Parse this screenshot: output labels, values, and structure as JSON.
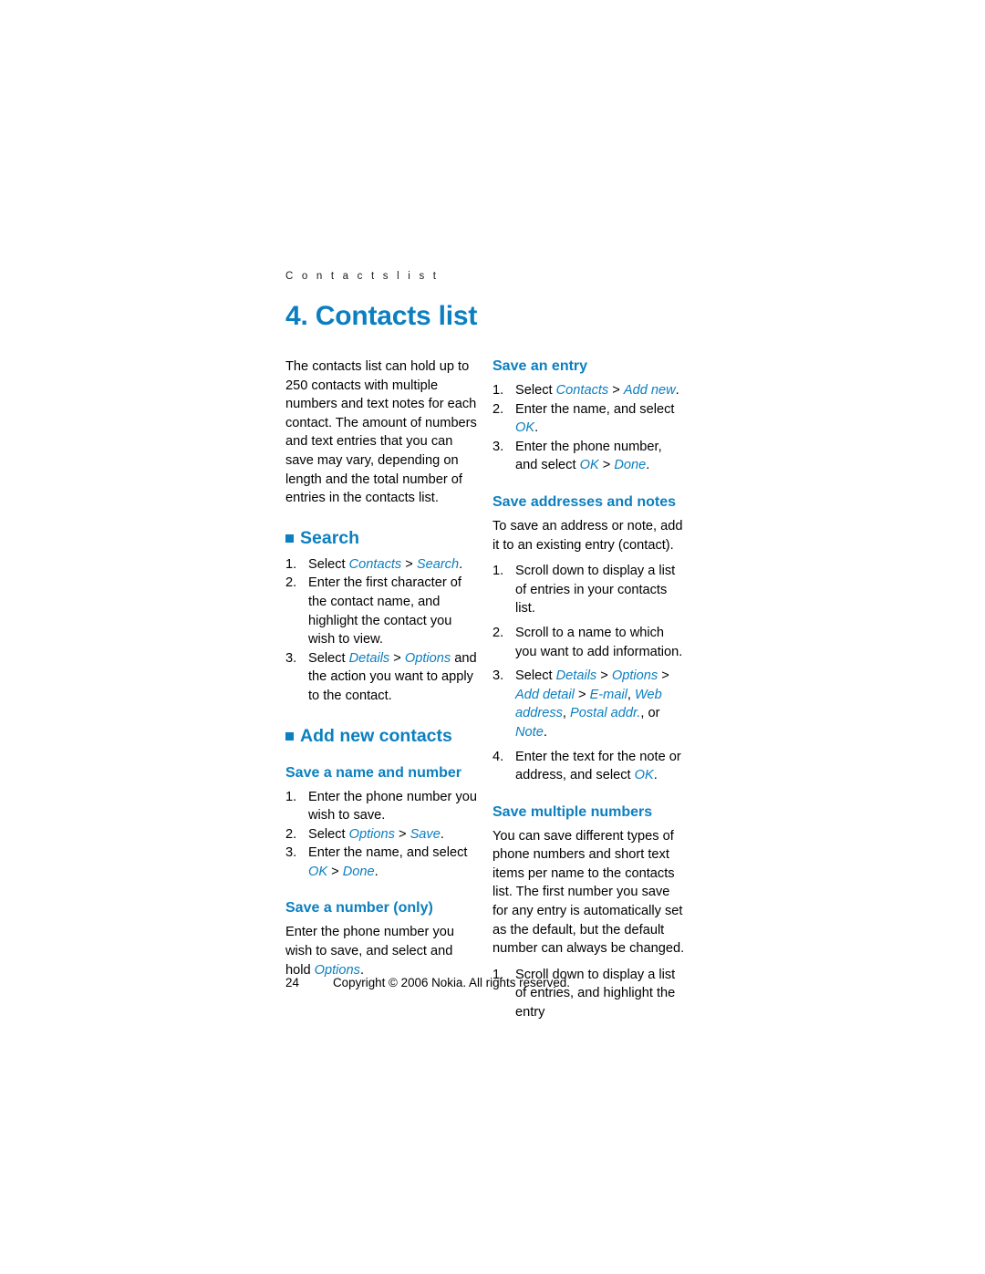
{
  "running_head": "C o n t a c t s   l i s t",
  "chapter_title": "4. Contacts list",
  "intro": "The contacts list can hold up to 250 contacts with multiple numbers and text notes for each contact. The amount of numbers and text entries that you can save may vary, depending on length and the total number of entries in the contacts list.",
  "sections": {
    "search": {
      "heading": "Search",
      "steps": [
        "Select Contacts > Search.",
        "Enter the first character of the contact name, and highlight the contact you wish to view.",
        "Select Details > Options and the action you want to apply to the contact."
      ]
    },
    "add_new_contacts": {
      "heading": "Add new contacts"
    },
    "save_name_and_number": {
      "heading": "Save a name and number",
      "steps": [
        "Enter the phone number you wish to save.",
        "Select Options > Save.",
        "Enter the name, and select OK > Done."
      ]
    },
    "save_number_only": {
      "heading": "Save a number (only)",
      "body": "Enter the phone number you wish to save, and select and hold Options."
    },
    "save_an_entry": {
      "heading": "Save an entry",
      "steps": [
        "Select Contacts > Add new.",
        "Enter the name, and select OK.",
        "Enter the phone number, and select OK > Done."
      ]
    },
    "save_addresses_and_notes": {
      "heading": "Save addresses and notes",
      "body": "To save an address or note, add it to an existing entry (contact).",
      "steps": [
        "Scroll down to display a list of entries in your contacts list.",
        "Scroll to a name to which you want to add information.",
        "Select Details > Options > Add detail > E-mail, Web address, Postal addr., or Note.",
        "Enter the text for the note or address, and select OK."
      ]
    },
    "save_multiple_numbers": {
      "heading": "Save multiple numbers",
      "body": "You can save different types of phone numbers and short text items per name to the contacts list. The first number you save for any entry is automatically set as the default, but the default number can always be changed.",
      "steps": [
        "Scroll down to display a list of entries, and highlight the entry"
      ]
    }
  },
  "footer": {
    "page_number": "24",
    "copyright": "Copyright © 2006 Nokia. All rights reserved."
  },
  "colors": {
    "accent": "#0b7fc0",
    "text": "#000000"
  }
}
